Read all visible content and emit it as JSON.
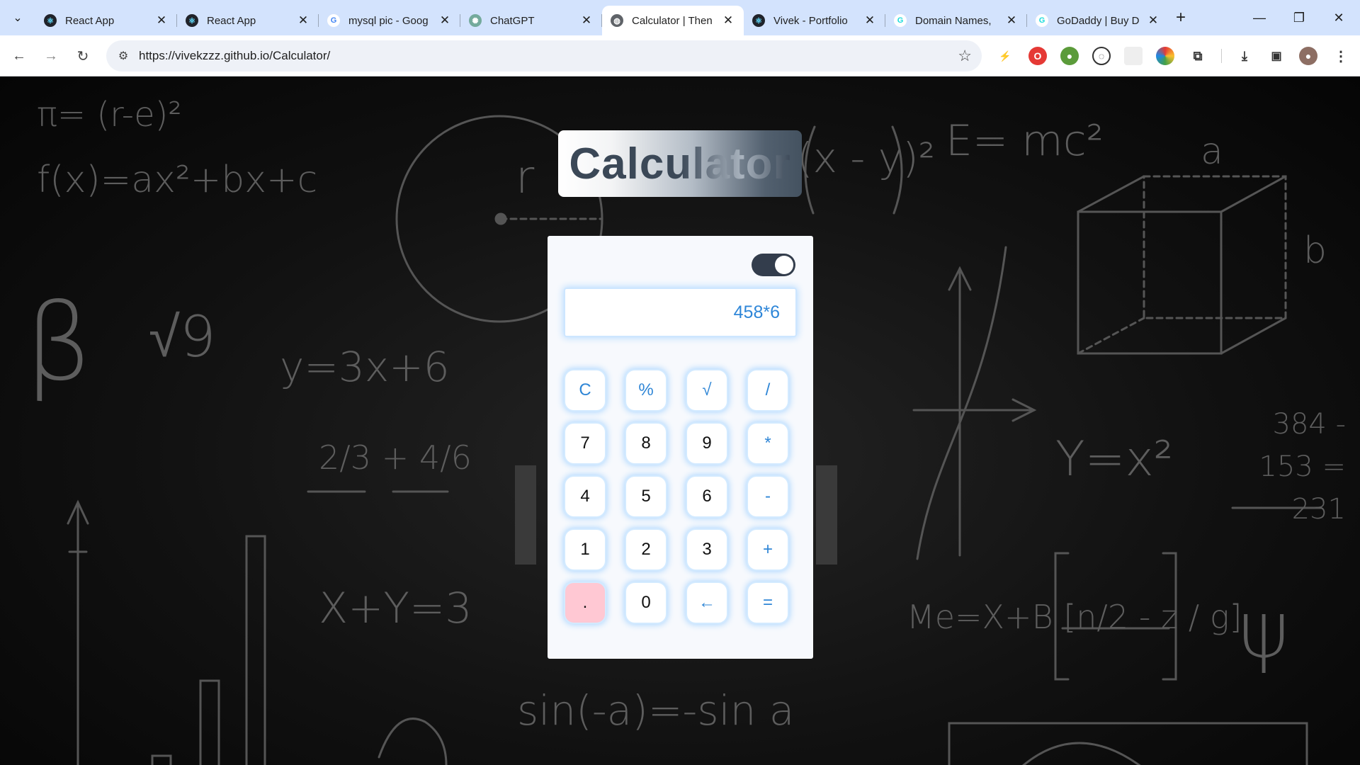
{
  "browser": {
    "tabs": [
      {
        "title": "React App",
        "favicon": "react-icon",
        "active": false
      },
      {
        "title": "React App",
        "favicon": "react-icon",
        "active": false
      },
      {
        "title": "mysql pic - Goog",
        "favicon": "google-icon",
        "active": false
      },
      {
        "title": "ChatGPT",
        "favicon": "chatgpt-icon",
        "active": false
      },
      {
        "title": "Calculator | Then",
        "favicon": "globe-icon",
        "active": true
      },
      {
        "title": "Vivek - Portfolio",
        "favicon": "react-icon",
        "active": false
      },
      {
        "title": "Domain Names,",
        "favicon": "godaddy-icon",
        "active": false
      },
      {
        "title": "GoDaddy | Buy D",
        "favicon": "godaddy-icon",
        "active": false
      }
    ],
    "url": "https://vivekzzz.github.io/Calculator/"
  },
  "app": {
    "title": "Calculator",
    "display_value": "458*6",
    "theme_toggle": "on",
    "keys": [
      {
        "label": "C",
        "kind": "op",
        "name": "clear"
      },
      {
        "label": "%",
        "kind": "op",
        "name": "percent"
      },
      {
        "label": "√",
        "kind": "op",
        "name": "sqrt"
      },
      {
        "label": "/",
        "kind": "op",
        "name": "divide"
      },
      {
        "label": "7",
        "kind": "num",
        "name": "7"
      },
      {
        "label": "8",
        "kind": "num",
        "name": "8"
      },
      {
        "label": "9",
        "kind": "num",
        "name": "9"
      },
      {
        "label": "*",
        "kind": "op",
        "name": "multiply"
      },
      {
        "label": "4",
        "kind": "num",
        "name": "4"
      },
      {
        "label": "5",
        "kind": "num",
        "name": "5"
      },
      {
        "label": "6",
        "kind": "num",
        "name": "6"
      },
      {
        "label": "-",
        "kind": "op",
        "name": "minus"
      },
      {
        "label": "1",
        "kind": "num",
        "name": "1"
      },
      {
        "label": "2",
        "kind": "num",
        "name": "2"
      },
      {
        "label": "3",
        "kind": "num",
        "name": "3"
      },
      {
        "label": "+",
        "kind": "op",
        "name": "plus"
      },
      {
        "label": ".",
        "kind": "dot",
        "name": "decimal"
      },
      {
        "label": "0",
        "kind": "num",
        "name": "0"
      },
      {
        "label": "←",
        "kind": "op",
        "name": "backspace"
      },
      {
        "label": "=",
        "kind": "op",
        "name": "equals"
      }
    ]
  },
  "background": {
    "formulas": [
      "π= (r-e)²",
      "f(x)=ax²+bx+c",
      "β",
      "√9",
      "y=3x+6",
      "2/3 + 4/6",
      "X+Y=3",
      "sin(-a)=-sin a",
      "E= mc²",
      "Y=x²",
      "384 - 153 = 231",
      "Me=X+B [n/2 - z / g]",
      "ψ",
      "(x - y)²",
      "r",
      "a",
      "b"
    ]
  },
  "colors": {
    "accent": "#2f86d6",
    "toggle": "#333d4c",
    "dot_key": "#ffc8d3",
    "tabstrip": "#d3e3fd"
  }
}
